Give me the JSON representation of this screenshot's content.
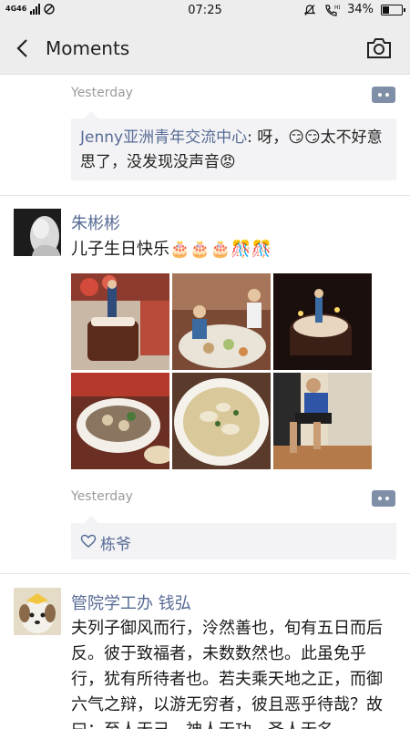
{
  "status_bar": {
    "network": "4G46",
    "time": "07:25",
    "battery": "34%",
    "battery_level": 0.34
  },
  "nav": {
    "title": "Moments"
  },
  "posts": [
    {
      "timestamp": "Yesterday",
      "comment": {
        "name": "Jenny亚洲青年交流中心",
        "text": ": 呀，😏😏太不好意思了，没发现没声音😡"
      }
    },
    {
      "author": "朱彬彬",
      "text": "儿子生日快乐🎂🎂🎂🎊🎊",
      "photos": [
        "birthday-cake-photo",
        "family-dinner-photo",
        "candle-cake-photo",
        "dumplings-plate-photo",
        "soup-bowl-photo",
        "boy-sitting-photo"
      ],
      "timestamp": "Yesterday",
      "likes": [
        "栋爷"
      ]
    },
    {
      "author": "管院学工办 钱弘",
      "text": "夫列子御风而行，泠然善也，旬有五日而后反。彼于致福者，未数数然也。此虽免乎行，犹有所待者也。若夫乘天地之正，而御六气之辩，以游无穷者，彼且恶乎待哉？故曰：至人无己，神人无功，圣人无名。"
    }
  ],
  "colors": {
    "link": "#576b95",
    "bar_bg": "#ededed",
    "comment_bg": "#f3f3f5"
  }
}
